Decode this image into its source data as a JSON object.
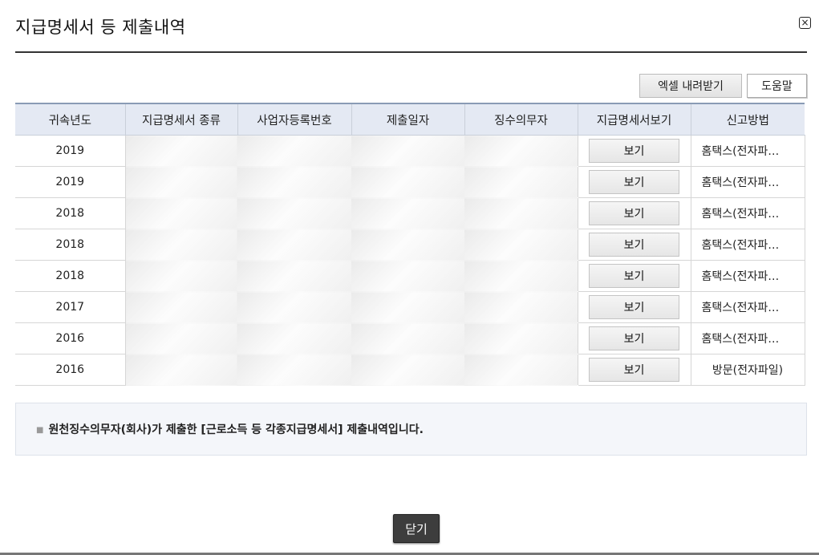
{
  "title": "지급명세서 등 제출내역",
  "close_icon": "×",
  "toolbar": {
    "excel_label": "엑셀 내려받기",
    "help_label": "도움말"
  },
  "table": {
    "headers": [
      "귀속년도",
      "지급명세서 종류",
      "사업자등록번호",
      "제출일자",
      "징수의무자",
      "지급명세서보기",
      "신고방법"
    ],
    "rows": [
      {
        "year": "2019",
        "view": "보기",
        "method": "홈택스(전자파…"
      },
      {
        "year": "2019",
        "view": "보기",
        "method": "홈택스(전자파…"
      },
      {
        "year": "2018",
        "view": "보기",
        "method": "홈택스(전자파…"
      },
      {
        "year": "2018",
        "view": "보기",
        "method": "홈택스(전자파…"
      },
      {
        "year": "2018",
        "view": "보기",
        "method": "홈택스(전자파…"
      },
      {
        "year": "2017",
        "view": "보기",
        "method": "홈택스(전자파…"
      },
      {
        "year": "2016",
        "view": "보기",
        "method": "홈택스(전자파…"
      },
      {
        "year": "2016",
        "view": "보기",
        "method": "방문(전자파일)"
      }
    ]
  },
  "info": {
    "bullet": "■",
    "text": "원천징수의무자(회사)가 제출한 [근로소득 등 각종지급명세서] 제출내역입니다."
  },
  "footer": {
    "close_label": "닫기"
  }
}
